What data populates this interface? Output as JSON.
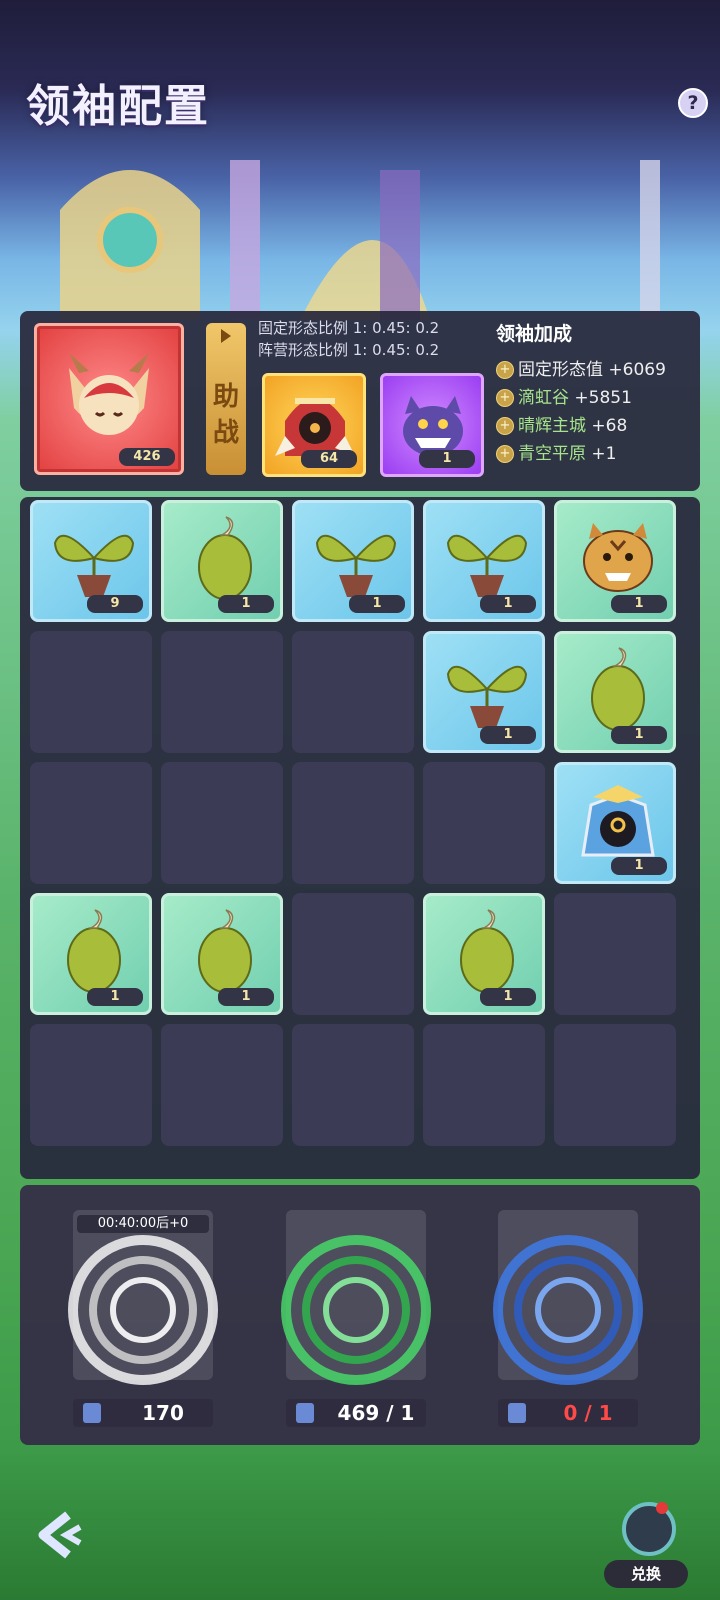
{
  "header": {
    "title": "领袖配置",
    "help_label": "?"
  },
  "leader": {
    "main_level": "426",
    "assist_label": "助战",
    "ratio_fixed": "固定形态比例 1: 0.45: 0.2",
    "ratio_camp": "阵营形态比例 1: 0.45: 0.2",
    "sub1_level": "64",
    "sub2_level": "1"
  },
  "bonus": {
    "title": "领袖加成",
    "rows": [
      {
        "name": "固定形态值",
        "value": "+6069"
      },
      {
        "name": "滴虹谷",
        "value": "+5851"
      },
      {
        "name": "晴辉主城",
        "value": "+68"
      },
      {
        "name": "青空平原",
        "value": "+1"
      }
    ]
  },
  "grid": {
    "cells": [
      {
        "kind": "sprout",
        "color": "blue",
        "count": "9"
      },
      {
        "kind": "seed",
        "color": "teal",
        "count": "1"
      },
      {
        "kind": "sprout",
        "color": "blue",
        "count": "1"
      },
      {
        "kind": "sprout",
        "color": "blue",
        "count": "1"
      },
      {
        "kind": "tiger",
        "color": "teal",
        "count": "1"
      },
      {
        "kind": "empty"
      },
      {
        "kind": "empty"
      },
      {
        "kind": "empty"
      },
      {
        "kind": "sprout",
        "color": "blue",
        "count": "1"
      },
      {
        "kind": "seed",
        "color": "teal",
        "count": "1"
      },
      {
        "kind": "empty"
      },
      {
        "kind": "empty"
      },
      {
        "kind": "empty"
      },
      {
        "kind": "empty"
      },
      {
        "kind": "knight",
        "color": "blue",
        "count": "1"
      },
      {
        "kind": "seed",
        "color": "teal",
        "count": "1"
      },
      {
        "kind": "seed",
        "color": "teal",
        "count": "1"
      },
      {
        "kind": "empty"
      },
      {
        "kind": "seed",
        "color": "teal",
        "count": "1"
      },
      {
        "kind": "empty"
      },
      {
        "kind": "empty"
      },
      {
        "kind": "empty"
      },
      {
        "kind": "empty"
      },
      {
        "kind": "empty"
      },
      {
        "kind": "empty"
      }
    ]
  },
  "portals": [
    {
      "timer": "00:40:00后+0",
      "count": "170",
      "color": "#ffffff",
      "count_color": "#ffffff"
    },
    {
      "count": "469 / 1",
      "color": "#48e06a",
      "count_color": "#ffffff"
    },
    {
      "count": "0 / 1",
      "color": "#3f7df0",
      "count_color": "#ff4a4a"
    }
  ],
  "footer": {
    "exchange_label": "兑换"
  }
}
